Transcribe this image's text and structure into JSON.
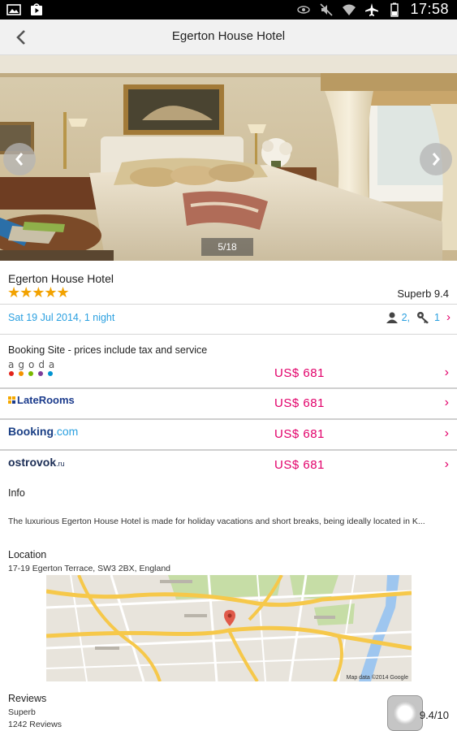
{
  "status_bar": {
    "time": "17:58",
    "left_icons": [
      "image-icon",
      "play-store-icon"
    ],
    "right_icons": [
      "eye-icon",
      "mute-icon",
      "wifi-icon",
      "airplane-icon",
      "battery-icon"
    ]
  },
  "action_bar": {
    "title": "Egerton House Hotel",
    "back_icon": "arrow-left-icon"
  },
  "gallery": {
    "counter": "5/18",
    "prev_icon": "chevron-left-icon",
    "next_icon": "chevron-right-icon"
  },
  "hotel": {
    "name": "Egerton House Hotel",
    "stars": "★★★★★",
    "star_count": 5,
    "rating_text": "Superb 9.4"
  },
  "search": {
    "dates": "Sat 19 Jul 2014, 1 night",
    "guests": "2,",
    "rooms": "1"
  },
  "booking": {
    "header": "Booking Site - prices include tax and service",
    "sites": [
      {
        "name": "agoda",
        "price": "US$ 681"
      },
      {
        "name": "LateRooms",
        "price": "US$ 681"
      },
      {
        "name": "Booking",
        "name_suffix": ".com",
        "price": "US$ 681"
      },
      {
        "name": "ostrovok",
        "name_suffix": ".ru",
        "price": "US$ 681"
      }
    ],
    "agoda_dot_colors": [
      "#e2231a",
      "#f39200",
      "#7ab800",
      "#7d3c98",
      "#0093d0"
    ]
  },
  "info": {
    "label": "Info",
    "text": "The luxurious Egerton House Hotel is made for holiday vacations and short breaks, being ideally located in K..."
  },
  "location": {
    "label": "Location",
    "address": "17-19 Egerton Terrace, SW3 2BX, England",
    "map_attribution": "Map data ©2014 Google"
  },
  "reviews": {
    "label": "Reviews",
    "word": "Superb",
    "count": "1242 Reviews",
    "score": "9.4/10"
  },
  "colors": {
    "price_pink": "#e2006a",
    "link_blue": "#2ba0e0",
    "star_gold": "#f2a200"
  }
}
